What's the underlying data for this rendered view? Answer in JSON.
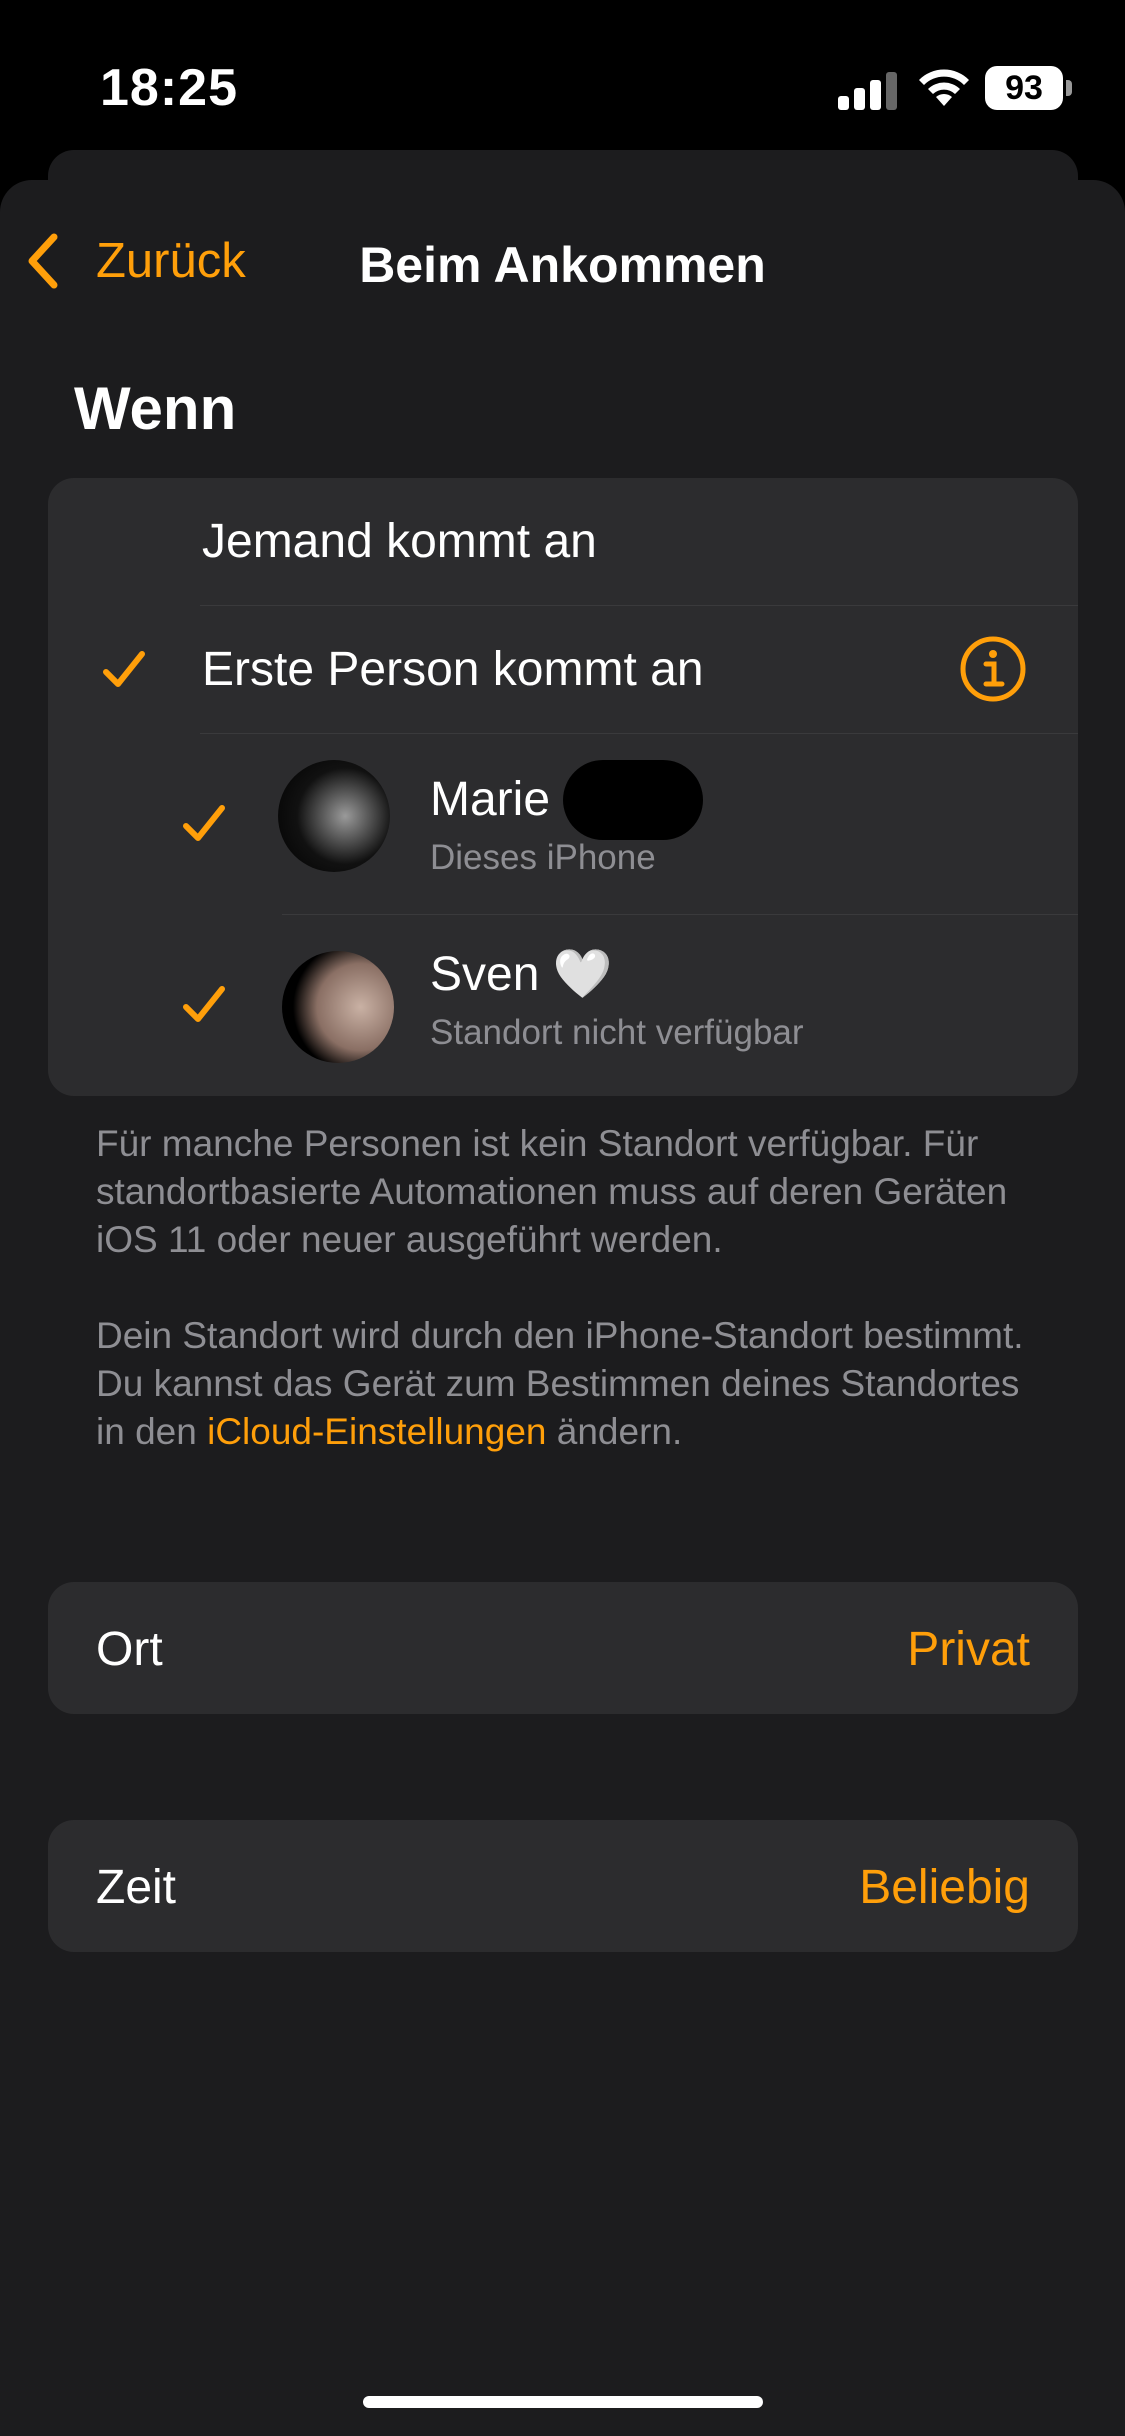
{
  "status_bar": {
    "time": "18:25",
    "battery": "93"
  },
  "nav": {
    "back_label": "Zurück",
    "title": "Beim Ankommen"
  },
  "section_title": "Wenn",
  "options": [
    {
      "label": "Jemand kommt an",
      "checked": false
    },
    {
      "label": "Erste Person kommt an",
      "checked": true
    }
  ],
  "people": [
    {
      "name": "Marie",
      "detail": "Dieses iPhone",
      "checked": true
    },
    {
      "name": "Sven 🤍",
      "detail": "Standort nicht verfügbar",
      "checked": true
    }
  ],
  "footer": {
    "note1": "Für manche Personen ist kein Standort verfügbar. Für standortbasierte Automationen muss auf deren Geräten iOS 11 oder neuer ausgeführt werden.",
    "note2_prefix": "Dein Standort wird durch den iPhone-Standort bestimmt. Du kannst das Gerät zum Bestimmen deines Standortes in den ",
    "note2_link": "iCloud-Einstellungen",
    "note2_suffix": " ändern."
  },
  "settings": [
    {
      "label": "Ort",
      "value": "Privat"
    },
    {
      "label": "Zeit",
      "value": "Beliebig"
    }
  ],
  "colors": {
    "accent": "#ff9f0a",
    "background": "#1c1c1e",
    "card": "#2c2c2e"
  }
}
